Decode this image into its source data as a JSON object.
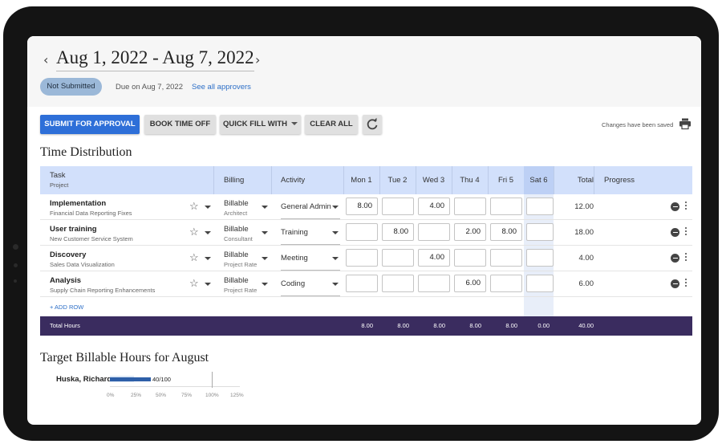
{
  "header": {
    "date_range": "Aug 1, 2022 - Aug 7, 2022",
    "prev_icon": "chevron-left-icon",
    "next_icon": "chevron-right-icon",
    "status": "Not Submitted",
    "due": "Due on Aug 7, 2022",
    "approvers_link": "See all approvers"
  },
  "toolbar": {
    "submit": "SUBMIT FOR APPROVAL",
    "book_time_off": "BOOK TIME OFF",
    "quick_fill": "QUICK FILL WITH",
    "clear_all": "CLEAR ALL",
    "refresh_icon": "refresh-icon",
    "saved_text": "Changes have been saved",
    "print_icon": "print-icon"
  },
  "time_distribution": {
    "title": "Time Distribution",
    "columns": {
      "task": "Task",
      "project": "Project",
      "billing": "Billing",
      "activity": "Activity",
      "days": [
        "Mon 1",
        "Tue 2",
        "Wed 3",
        "Thu 4",
        "Fri 5",
        "Sat 6"
      ],
      "total": "Total",
      "progress": "Progress"
    },
    "rows": [
      {
        "task": "Implementation",
        "project": "Financial Data Reporting Fixes",
        "billing": "Billable",
        "billing_role": "Architect",
        "activity": "General Admin",
        "hours": [
          "8.00",
          "",
          "4.00",
          "",
          "",
          ""
        ],
        "total": "12.00"
      },
      {
        "task": "User training",
        "project": "New Customer Service System",
        "billing": "Billable",
        "billing_role": "Consultant",
        "activity": "Training",
        "hours": [
          "",
          "8.00",
          "",
          "2.00",
          "8.00",
          ""
        ],
        "total": "18.00"
      },
      {
        "task": "Discovery",
        "project": "Sales Data Visualization",
        "billing": "Billable",
        "billing_role": "Project Rate",
        "activity": "Meeting",
        "hours": [
          "",
          "",
          "4.00",
          "",
          "",
          ""
        ],
        "total": "4.00"
      },
      {
        "task": "Analysis",
        "project": "Supply Chain Reporting Enhancements",
        "billing": "Billable",
        "billing_role": "Project Rate",
        "activity": "Coding",
        "hours": [
          "",
          "",
          "",
          "6.00",
          "",
          ""
        ],
        "total": "6.00"
      }
    ],
    "add_row": "+ ADD ROW",
    "totals": {
      "label": "Total Hours",
      "days": [
        "8.00",
        "8.00",
        "8.00",
        "8.00",
        "8.00",
        "0.00"
      ],
      "total": "40.00"
    }
  },
  "target": {
    "title": "Target Billable Hours for August",
    "person": "Huska, Richard",
    "value_label": "40/100",
    "progress_fraction": 0.4,
    "ticks": [
      "0%",
      "25%",
      "50%",
      "75%",
      "100%",
      "125%"
    ]
  },
  "colors": {
    "primary": "#2e6fd8",
    "header_bg": "#d2e0fb",
    "totals_bg": "#3a2c5f",
    "status_pill": "#9bb8d8",
    "bar_fill": "#2e5fa8"
  }
}
